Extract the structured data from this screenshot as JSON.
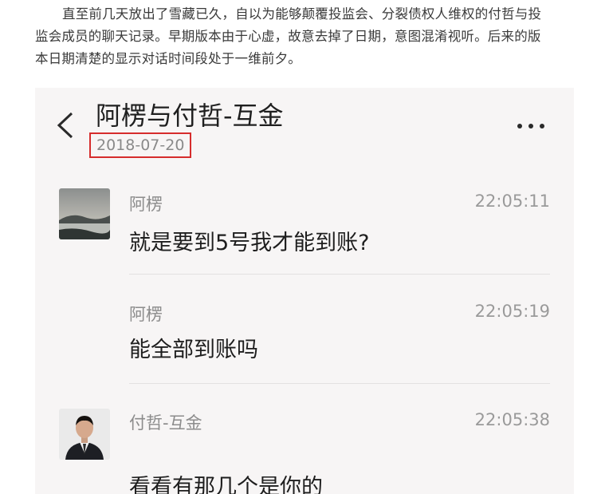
{
  "intro": {
    "line1": "直至前几天放出了雪藏已久，自以为能够颠覆投监会、分裂债权人维权的付哲与投",
    "line2": "监会成员的聊天记录。早期版本由于心虚，故意去掉了日期，意图混淆视听。后来的版",
    "line3": "本日期清楚的显示对话时间段处于一维前夕。"
  },
  "chat": {
    "title": "阿楞与付哲-互金",
    "date": "2018-07-20",
    "back_icon": "chevron-left-icon",
    "more_icon": "more-horizontal-icon",
    "highlight_color": "#d62c2c",
    "messages": [
      {
        "sender": "阿楞",
        "time": "22:05:11",
        "text": "就是要到5号我才能到账?",
        "avatar": "landscape-avatar"
      },
      {
        "sender": "阿楞",
        "time": "22:05:19",
        "text": "能全部到账吗",
        "avatar": ""
      },
      {
        "sender": "付哲-互金",
        "time": "22:05:38",
        "text": "看看有那几个是你的",
        "avatar": "person-avatar"
      }
    ]
  }
}
